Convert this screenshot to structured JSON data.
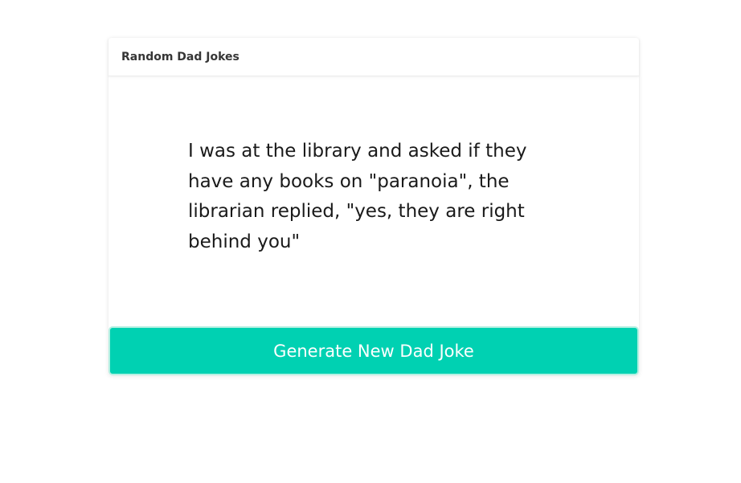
{
  "card": {
    "title": "Random Dad Jokes",
    "joke": "I was at the library and asked if they have any books on \"paranoia\", the librarian replied, \"yes, they are right behind you\"",
    "button_label": "Generate New Dad Joke"
  },
  "colors": {
    "accent": "#00d1b2",
    "text": "#1a1a1a",
    "title": "#363636"
  }
}
